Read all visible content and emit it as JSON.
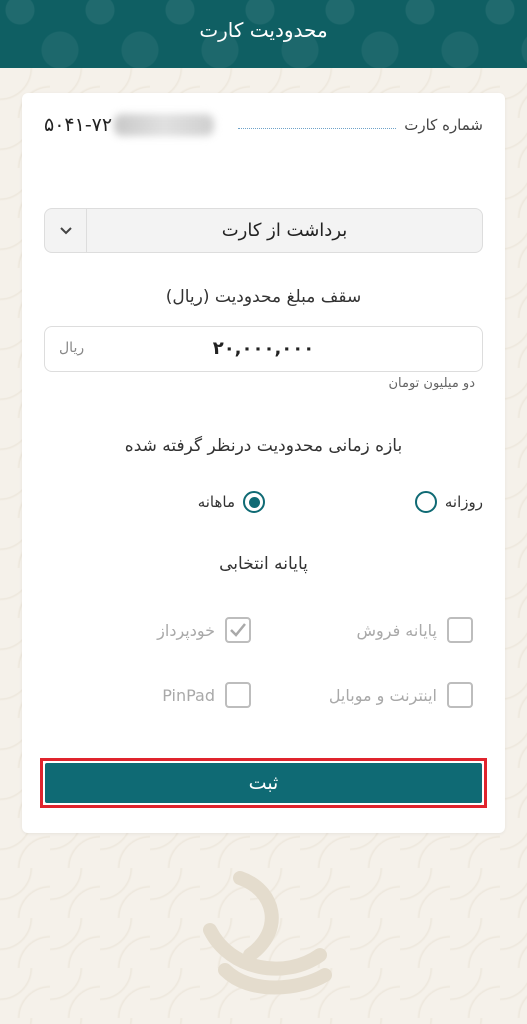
{
  "header": {
    "title": "محدودیت کارت"
  },
  "card_info": {
    "label": "شماره کارت",
    "number_visible": "۵۰۴۱-۷۲"
  },
  "transaction_type": {
    "selected": "برداشت از کارت"
  },
  "limit": {
    "title": "سقف مبلغ محدودیت (ریال)",
    "value": "۲۰,۰۰۰,۰۰۰",
    "unit": "ریال",
    "in_words": "دو میلیون تومان"
  },
  "period": {
    "title": "بازه زمانی محدودیت درنظر گرفته شده",
    "options": [
      {
        "label": "روزانه",
        "selected": false
      },
      {
        "label": "ماهانه",
        "selected": true
      }
    ]
  },
  "terminals": {
    "title": "پایانه انتخابی",
    "options": [
      {
        "label": "پایانه فروش",
        "checked": false
      },
      {
        "label": "خودپرداز",
        "checked": true
      },
      {
        "label": "اینترنت و موبایل",
        "checked": false
      },
      {
        "label": "PinPad",
        "checked": false
      }
    ]
  },
  "submit": {
    "label": "ثبت"
  },
  "colors": {
    "primary": "#0f6a74",
    "header": "#0f5f63",
    "highlight_border": "#e0242d",
    "background": "#f5f1ea"
  }
}
